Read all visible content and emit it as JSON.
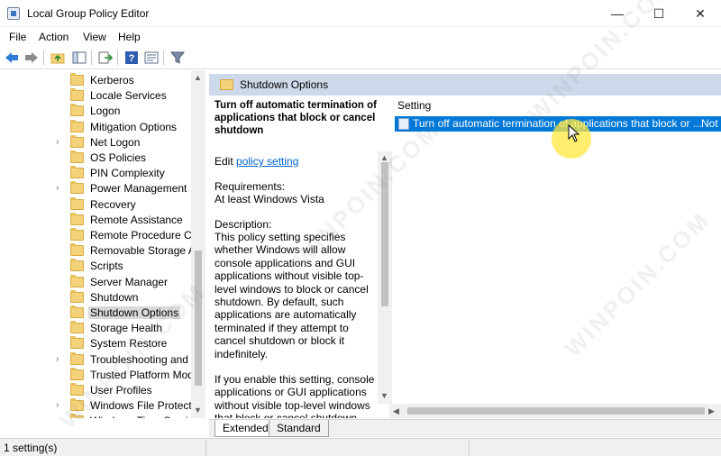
{
  "window": {
    "title": "Local Group Policy Editor",
    "min_glyph": "—",
    "max_glyph": "☐",
    "close_glyph": "✕"
  },
  "menu": [
    "File",
    "Action",
    "View",
    "Help"
  ],
  "toolbar": {
    "icons": [
      "back-arrow-icon",
      "forward-arrow-icon",
      "up-folder-icon",
      "show-hide-tree-icon",
      "export-list-icon",
      "help-icon",
      "properties-icon",
      "filter-icon"
    ]
  },
  "tree": {
    "items": [
      {
        "label": "Kerberos",
        "expandable": false,
        "selected": false
      },
      {
        "label": "Locale Services",
        "expandable": false,
        "selected": false
      },
      {
        "label": "Logon",
        "expandable": false,
        "selected": false
      },
      {
        "label": "Mitigation Options",
        "expandable": false,
        "selected": false
      },
      {
        "label": "Net Logon",
        "expandable": true,
        "selected": false
      },
      {
        "label": "OS Policies",
        "expandable": false,
        "selected": false
      },
      {
        "label": "PIN Complexity",
        "expandable": false,
        "selected": false
      },
      {
        "label": "Power Management",
        "expandable": true,
        "selected": false
      },
      {
        "label": "Recovery",
        "expandable": false,
        "selected": false
      },
      {
        "label": "Remote Assistance",
        "expandable": false,
        "selected": false
      },
      {
        "label": "Remote Procedure Cal",
        "expandable": false,
        "selected": false
      },
      {
        "label": "Removable Storage Ac",
        "expandable": false,
        "selected": false
      },
      {
        "label": "Scripts",
        "expandable": false,
        "selected": false
      },
      {
        "label": "Server Manager",
        "expandable": false,
        "selected": false
      },
      {
        "label": "Shutdown",
        "expandable": false,
        "selected": false
      },
      {
        "label": "Shutdown Options",
        "expandable": false,
        "selected": true
      },
      {
        "label": "Storage Health",
        "expandable": false,
        "selected": false
      },
      {
        "label": "System Restore",
        "expandable": false,
        "selected": false
      },
      {
        "label": "Troubleshooting and D",
        "expandable": true,
        "selected": false
      },
      {
        "label": "Trusted Platform Mod",
        "expandable": false,
        "selected": false
      },
      {
        "label": "User Profiles",
        "expandable": false,
        "selected": false
      },
      {
        "label": "Windows File Protectic",
        "expandable": true,
        "selected": false
      },
      {
        "label": "Windows Time Service",
        "expandable": true,
        "selected": false
      }
    ]
  },
  "detail": {
    "header": "Shutdown Options",
    "policy_title": "Turn off automatic termination of applications that block or cancel shutdown",
    "edit_prefix": "Edit",
    "edit_link": "policy setting",
    "requirements_label": "Requirements:",
    "requirements_value": "At least Windows Vista",
    "description_label": "Description:",
    "description_text": "This policy setting specifies whether Windows will allow console applications and GUI applications without visible top-level windows to block or cancel shutdown. By default, such applications are automatically terminated if they attempt to cancel shutdown or block it indefinitely.",
    "description_more": "If you enable this setting, console applications or GUI applications without visible top-level windows that block or cancel shutdown will"
  },
  "list": {
    "column_setting": "Setting",
    "rows": [
      {
        "setting": "Turn off automatic termination of applications that block or ...",
        "state": "Not"
      }
    ]
  },
  "tabs": [
    "Extended",
    "Standard"
  ],
  "status": {
    "text": "1 setting(s)"
  },
  "colors": {
    "selection": "#0078d7",
    "header_band": "#cdd9ea",
    "link": "#0066cc"
  },
  "watermark": "WINPOIN.COM"
}
